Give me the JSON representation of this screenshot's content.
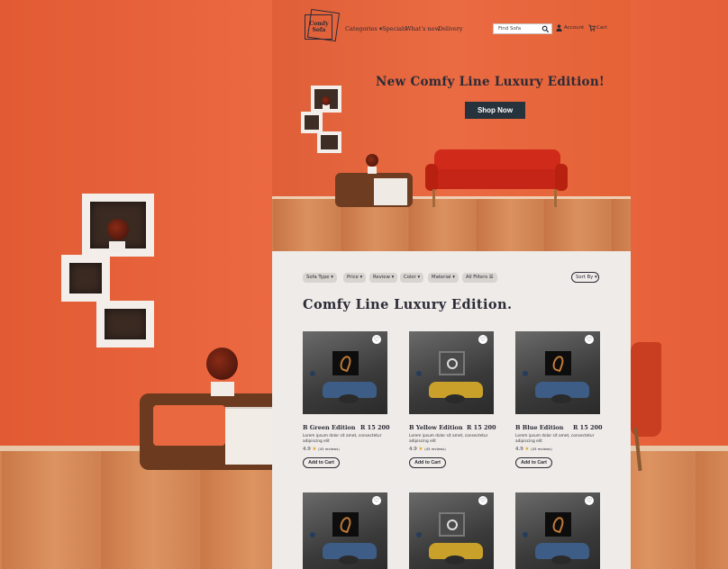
{
  "brand": {
    "logo_text": "Comfy Sofa"
  },
  "nav": {
    "categories": "Categories ▾",
    "specials": "Specials",
    "whats_new": "What's new",
    "delivery": "Delivery"
  },
  "header": {
    "search_placeholder": "Find Sofa",
    "account": "Account",
    "cart": "Cart"
  },
  "hero": {
    "title": "New Comfy Line Luxury Edition!",
    "cta": "Shop Now"
  },
  "filters": [
    "Sofa Type ▾",
    "Price ▾",
    "Review ▾",
    "Color ▾",
    "Material ▾",
    "All Filters ☰"
  ],
  "sort_label": "Sort By ▾",
  "section_title": "Comfy Line Luxury Edition.",
  "products": [
    {
      "name": "B Green Edition",
      "price": "R 15 200",
      "desc": "Lorem ipsum dolor sit amet, consectetur adipiscing elit",
      "rating": "4.9",
      "reviews": "(45 reviews)",
      "cta": "Add to Cart"
    },
    {
      "name": "B Yellow Edition",
      "price": "R 15 200",
      "desc": "Lorem ipsum dolor sit amet, consectetur adipiscing elit",
      "rating": "4.9",
      "reviews": "(45 reviews)",
      "cta": "Add to Cart"
    },
    {
      "name": "B Blue Edition",
      "price": "R 15 200",
      "desc": "Lorem ipsum dolor sit amet, consectetur adipiscing elit",
      "rating": "4.9",
      "reviews": "(45 reviews)",
      "cta": "Add to Cart"
    }
  ],
  "colors": {
    "dark": "#26323c",
    "accent_orange": "#e9683f",
    "panel_bg": "#eeebe8",
    "star": "#e2a415"
  }
}
